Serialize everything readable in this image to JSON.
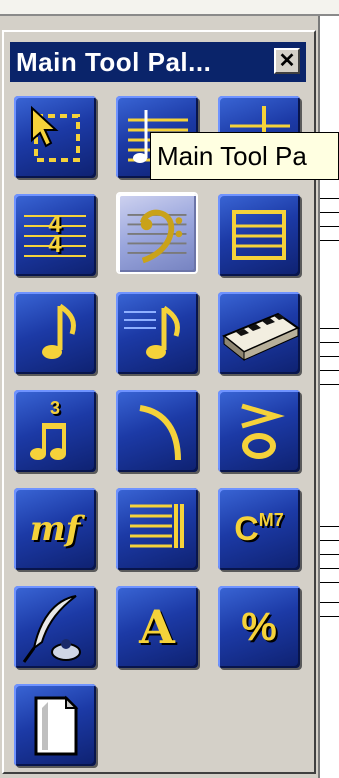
{
  "palette": {
    "title": "Main Tool Pal...",
    "close_glyph": "✕"
  },
  "tooltip": {
    "text": "Main Tool Pa"
  },
  "tools": [
    {
      "icon": "selection-tool-icon"
    },
    {
      "icon": "staff-note-tool-icon"
    },
    {
      "icon": "note-on-staff-tool-icon"
    },
    {
      "icon": "time-signature-tool-icon",
      "glyph_top": "4",
      "glyph_bottom": "4"
    },
    {
      "icon": "clef-tool-icon",
      "selected": true
    },
    {
      "icon": "measure-tool-icon"
    },
    {
      "icon": "simple-entry-note-icon"
    },
    {
      "icon": "speedy-entry-icon"
    },
    {
      "icon": "keyboard-hyperscribe-icon"
    },
    {
      "icon": "tuplet-tool-icon",
      "glyph": "3"
    },
    {
      "icon": "smart-shape-slur-icon"
    },
    {
      "icon": "articulation-tool-icon"
    },
    {
      "icon": "expression-tool-icon",
      "glyph": "mf"
    },
    {
      "icon": "repeat-tool-icon"
    },
    {
      "icon": "chord-tool-icon",
      "glyph_main": "C",
      "glyph_sup": "M7"
    },
    {
      "icon": "lyrics-tool-icon"
    },
    {
      "icon": "text-tool-icon",
      "glyph": "A"
    },
    {
      "icon": "resize-tool-icon",
      "glyph": "%"
    },
    {
      "icon": "page-layout-tool-icon"
    }
  ],
  "colors": {
    "accent": "#f5d23a",
    "button_blue": "#1c3aa6",
    "title_bar": "#0a246a"
  }
}
